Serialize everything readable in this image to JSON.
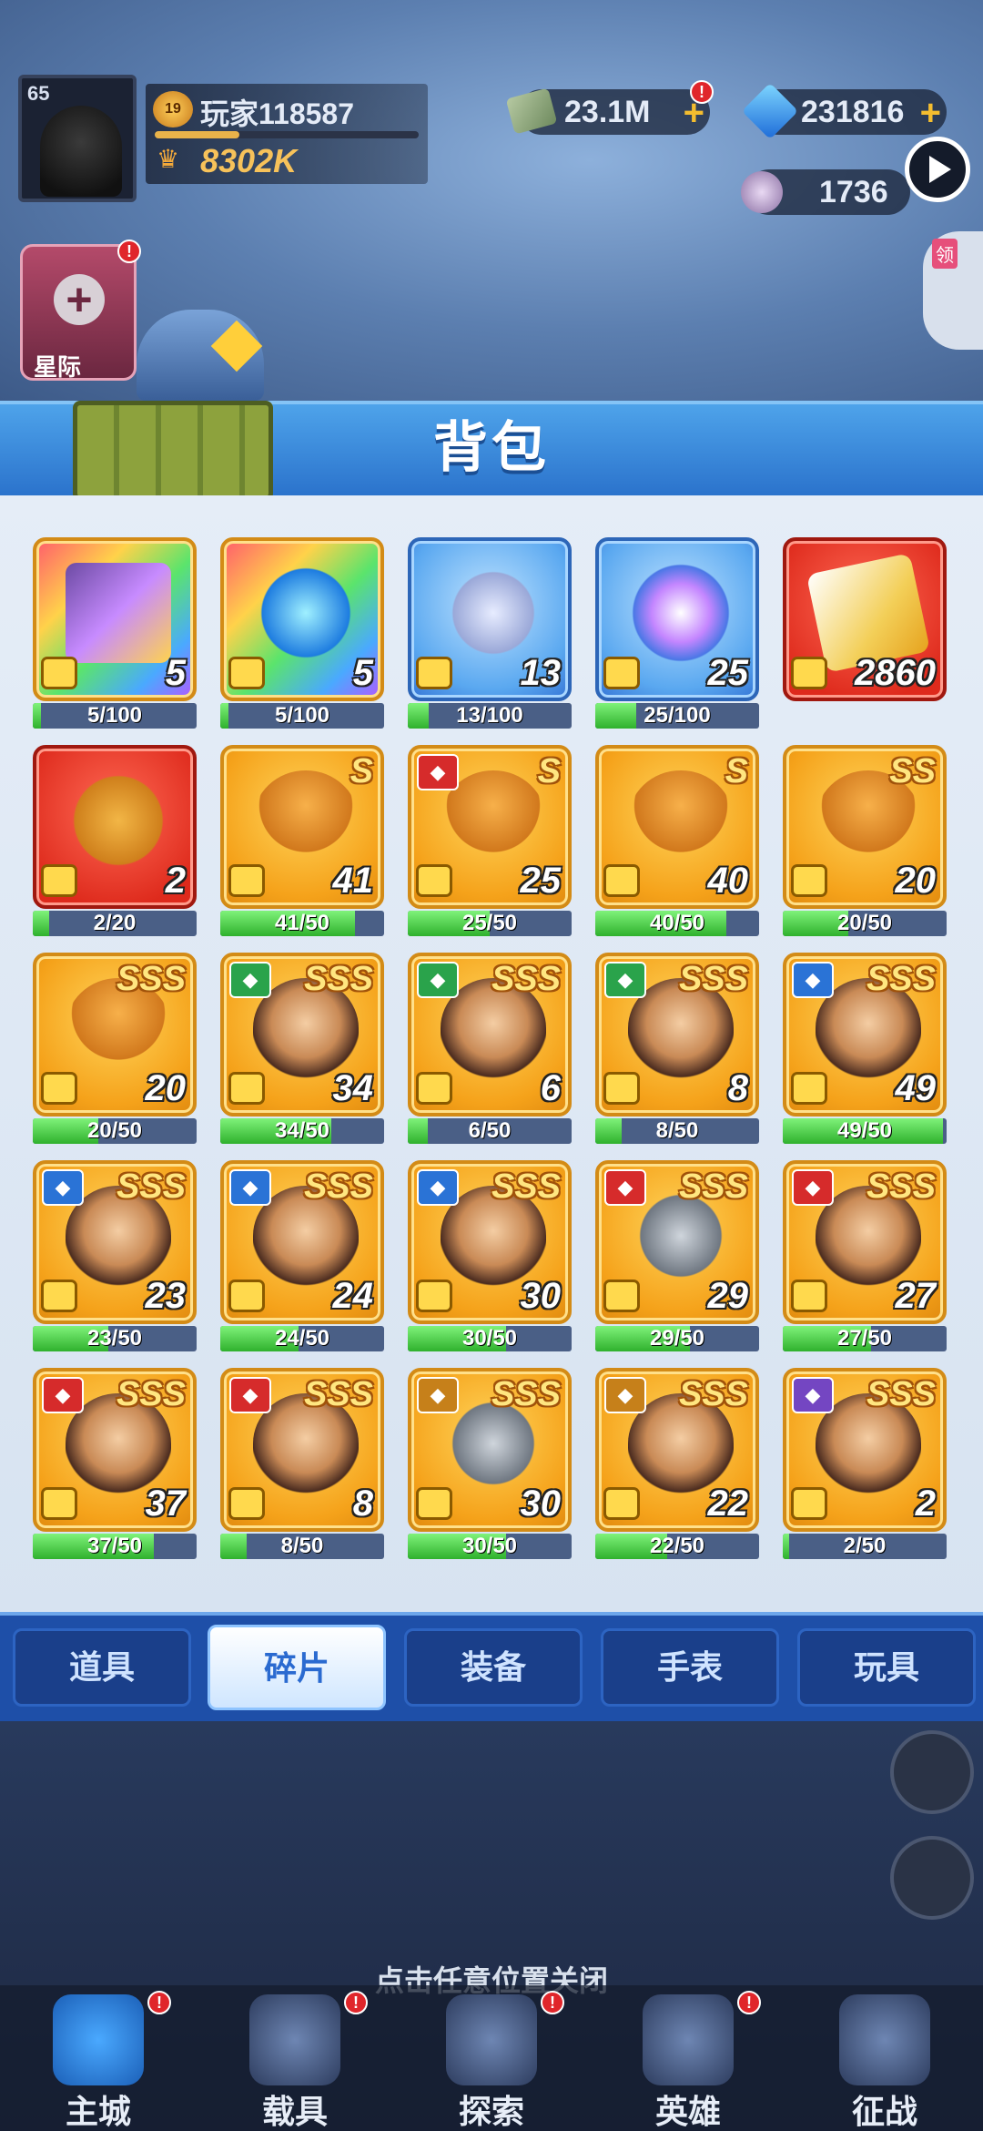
{
  "hud": {
    "avatar_level": "65",
    "rank_level": "19",
    "player_name": "玩家118587",
    "power": "8302K",
    "money": "23.1M",
    "gems": "231816",
    "coins": "1736",
    "exp_progress": 0.32,
    "side_tab_tag": "领",
    "left_event_label": "星际"
  },
  "panel": {
    "title": "背包"
  },
  "items": [
    {
      "kind": "rainbow",
      "art": "chest",
      "qty": "5",
      "progress": "5/100",
      "fill": 0.05,
      "grade": "",
      "faction": ""
    },
    {
      "kind": "rainbow",
      "art": "watch",
      "qty": "5",
      "progress": "5/100",
      "fill": 0.05,
      "grade": "",
      "faction": ""
    },
    {
      "kind": "blue",
      "art": "toy",
      "qty": "13",
      "progress": "13/100",
      "fill": 0.13,
      "grade": "",
      "faction": ""
    },
    {
      "kind": "blue",
      "art": "orb",
      "qty": "25",
      "progress": "25/100",
      "fill": 0.25,
      "grade": "",
      "faction": ""
    },
    {
      "kind": "red",
      "art": "ticket",
      "qty": "2860",
      "progress": "",
      "fill": 0,
      "grade": "",
      "faction": ""
    },
    {
      "kind": "red",
      "art": "dog",
      "qty": "2",
      "progress": "2/20",
      "fill": 0.1,
      "grade": "",
      "faction": ""
    },
    {
      "kind": "gold",
      "art": "helmet",
      "qty": "41",
      "progress": "41/50",
      "fill": 0.82,
      "grade": "S",
      "faction": ""
    },
    {
      "kind": "gold",
      "art": "helmet",
      "qty": "25",
      "progress": "25/50",
      "fill": 0.5,
      "grade": "S",
      "faction": "red"
    },
    {
      "kind": "gold",
      "art": "helmet",
      "qty": "40",
      "progress": "40/50",
      "fill": 0.8,
      "grade": "S",
      "faction": ""
    },
    {
      "kind": "gold",
      "art": "helmet",
      "qty": "20",
      "progress": "20/50",
      "fill": 0.4,
      "grade": "SS",
      "faction": ""
    },
    {
      "kind": "gold",
      "art": "helmet",
      "qty": "20",
      "progress": "20/50",
      "fill": 0.4,
      "grade": "SSS",
      "faction": ""
    },
    {
      "kind": "gold",
      "art": "hero",
      "qty": "34",
      "progress": "34/50",
      "fill": 0.68,
      "grade": "SSS",
      "faction": "green"
    },
    {
      "kind": "gold",
      "art": "hero",
      "qty": "6",
      "progress": "6/50",
      "fill": 0.12,
      "grade": "SSS",
      "faction": "green"
    },
    {
      "kind": "gold",
      "art": "hero",
      "qty": "8",
      "progress": "8/50",
      "fill": 0.16,
      "grade": "SSS",
      "faction": "green"
    },
    {
      "kind": "gold",
      "art": "hero",
      "qty": "49",
      "progress": "49/50",
      "fill": 0.98,
      "grade": "SSS",
      "faction": "blue"
    },
    {
      "kind": "gold",
      "art": "hero",
      "qty": "23",
      "progress": "23/50",
      "fill": 0.46,
      "grade": "SSS",
      "faction": "blue"
    },
    {
      "kind": "gold",
      "art": "hero",
      "qty": "24",
      "progress": "24/50",
      "fill": 0.48,
      "grade": "SSS",
      "faction": "blue"
    },
    {
      "kind": "gold",
      "art": "hero",
      "qty": "30",
      "progress": "30/50",
      "fill": 0.6,
      "grade": "SSS",
      "faction": "blue"
    },
    {
      "kind": "gold",
      "art": "robot",
      "qty": "29",
      "progress": "29/50",
      "fill": 0.58,
      "grade": "SSS",
      "faction": "red"
    },
    {
      "kind": "gold",
      "art": "hero",
      "qty": "27",
      "progress": "27/50",
      "fill": 0.54,
      "grade": "SSS",
      "faction": "red"
    },
    {
      "kind": "gold",
      "art": "hero",
      "qty": "37",
      "progress": "37/50",
      "fill": 0.74,
      "grade": "SSS",
      "faction": "red"
    },
    {
      "kind": "gold",
      "art": "hero",
      "qty": "8",
      "progress": "8/50",
      "fill": 0.16,
      "grade": "SSS",
      "faction": "red"
    },
    {
      "kind": "gold",
      "art": "robot",
      "qty": "30",
      "progress": "30/50",
      "fill": 0.6,
      "grade": "SSS",
      "faction": "gold"
    },
    {
      "kind": "gold",
      "art": "hero",
      "qty": "22",
      "progress": "22/50",
      "fill": 0.44,
      "grade": "SSS",
      "faction": "gold"
    },
    {
      "kind": "gold",
      "art": "hero",
      "qty": "2",
      "progress": "2/50",
      "fill": 0.04,
      "grade": "SSS",
      "faction": "purple"
    }
  ],
  "tabs": [
    {
      "label": "道具",
      "active": false
    },
    {
      "label": "碎片",
      "active": true
    },
    {
      "label": "装备",
      "active": false
    },
    {
      "label": "手表",
      "active": false
    },
    {
      "label": "玩具",
      "active": false
    }
  ],
  "close_hint": "点击任意位置关闭",
  "nav": [
    {
      "label": "主城",
      "active": true
    },
    {
      "label": "载具",
      "active": false
    },
    {
      "label": "探索",
      "active": false
    },
    {
      "label": "英雄",
      "active": false
    },
    {
      "label": "征战",
      "active": false
    }
  ]
}
